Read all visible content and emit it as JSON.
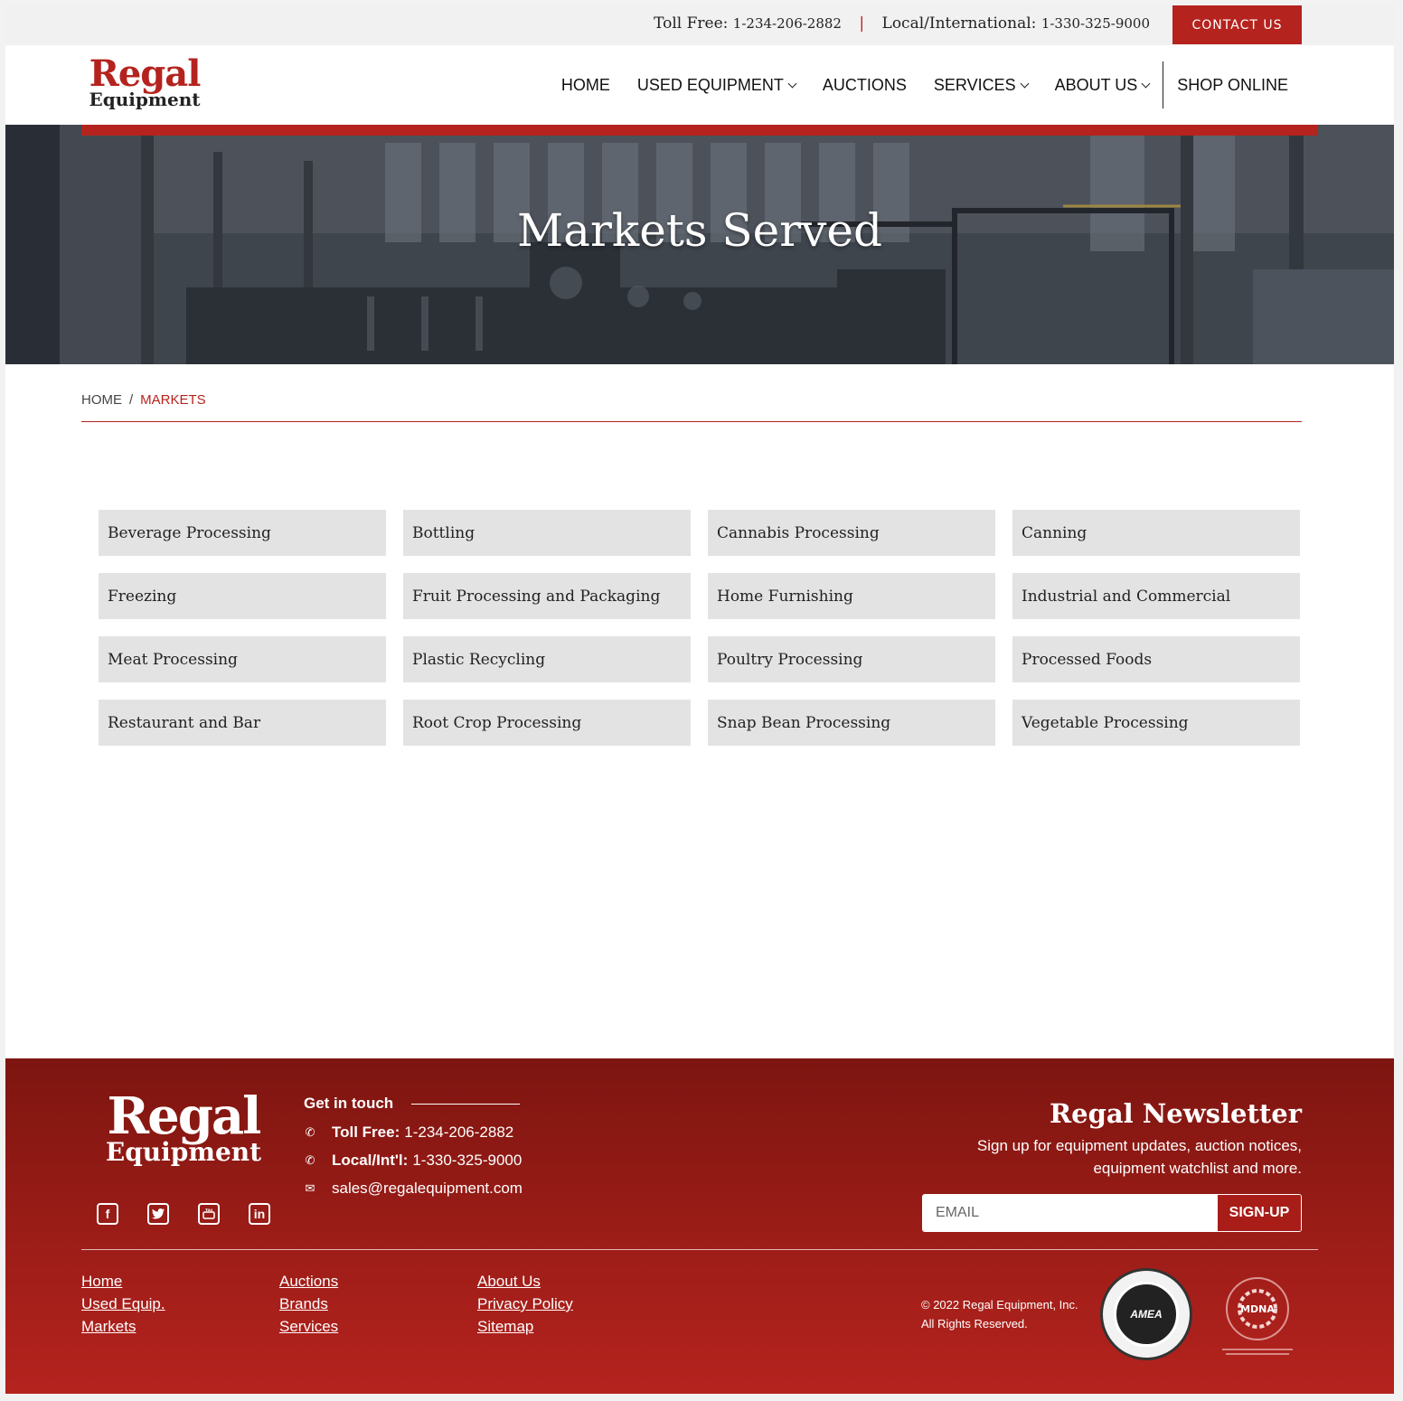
{
  "topbar": {
    "toll_free_label": "Toll Free:",
    "toll_free_number": "1-234-206-2882",
    "separator": "|",
    "local_label": "Local/International:",
    "local_number": "1-330-325-9000",
    "contact_button": "CONTACT US"
  },
  "brand": {
    "line1": "Regal",
    "line2": "Equipment",
    "accent": "#b5231e"
  },
  "nav": {
    "items": [
      {
        "label": "HOME",
        "dropdown": false
      },
      {
        "label": "USED EQUIPMENT",
        "dropdown": true
      },
      {
        "label": "AUCTIONS",
        "dropdown": false
      },
      {
        "label": "SERVICES",
        "dropdown": true
      },
      {
        "label": "ABOUT US",
        "dropdown": true
      },
      {
        "label": "SHOP ONLINE",
        "dropdown": false
      }
    ]
  },
  "hero": {
    "title": "Markets Served"
  },
  "breadcrumb": {
    "home": "HOME",
    "separator": "/",
    "current": "MARKETS"
  },
  "markets": [
    "Beverage Processing",
    "Bottling",
    "Cannabis Processing",
    "Canning",
    "Freezing",
    "Fruit Processing and Packaging",
    "Home Furnishing",
    "Industrial and Commercial",
    "Meat Processing",
    "Plastic Recycling",
    "Poultry Processing",
    "Processed Foods",
    "Restaurant and Bar",
    "Root Crop Processing",
    "Snap Bean Processing",
    "Vegetable Processing"
  ],
  "footer": {
    "get_in_touch": "Get in touch",
    "toll_free_label": "Toll Free:",
    "toll_free_number": "1-234-206-2882",
    "local_label": "Local/Int'l:",
    "local_number": "1-330-325-9000",
    "email": "sales@regalequipment.com",
    "social_icons": [
      "facebook-icon",
      "twitter-icon",
      "youtube-icon",
      "linkedin-icon"
    ],
    "newsletter_title": "Regal Newsletter",
    "newsletter_desc_1": "Sign up for equipment updates, auction notices,",
    "newsletter_desc_2": "equipment watchlist and more.",
    "email_placeholder": "EMAIL",
    "signup_button": "SIGN-UP",
    "links_col1": [
      "Home",
      "Used Equip.",
      "Markets"
    ],
    "links_col2": [
      "Auctions",
      "Brands",
      "Services"
    ],
    "links_col3": [
      "About Us",
      "Privacy Policy",
      "Sitemap"
    ],
    "copyright_1": "© 2022 Regal Equipment, Inc.",
    "copyright_2": "All Rights Reserved.",
    "badge1_text": "AMEA",
    "badge2_text": "MDNA"
  }
}
